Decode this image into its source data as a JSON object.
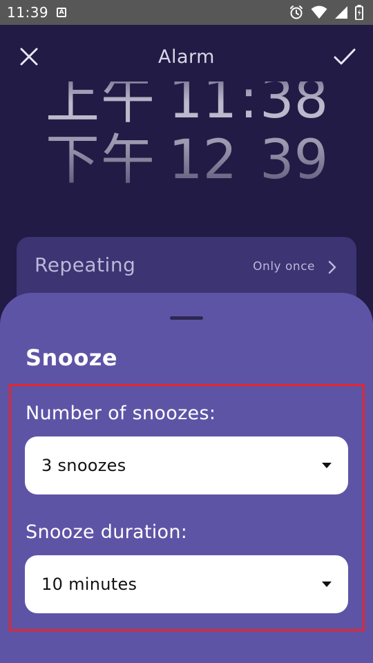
{
  "status_bar": {
    "time": "11:39",
    "notification_icon_letter": "A",
    "icons": [
      "alarm-icon",
      "wifi-icon",
      "signal-icon",
      "battery-icon"
    ]
  },
  "app_bar": {
    "title": "Alarm",
    "close_icon": "close-icon",
    "save_icon": "check-icon"
  },
  "time_picker": {
    "previous": {
      "period": "上午",
      "hour": "11",
      "separator": ":",
      "minute": "38"
    },
    "selected": {
      "period": "下午",
      "hour": "12",
      "separator": "",
      "minute": "39"
    }
  },
  "repeating": {
    "label": "Repeating",
    "value": "Only once",
    "icon": "chevron-right-icon"
  },
  "snooze_sheet": {
    "title": "Snooze",
    "number_of_snoozes": {
      "label": "Number of snoozes:",
      "value": "3 snoozes"
    },
    "snooze_duration": {
      "label": "Snooze duration:",
      "value": "10 minutes"
    }
  },
  "colors": {
    "background": "#211b45",
    "status_bar": "#575757",
    "card": "#3c3473",
    "sheet": "#5e54a6",
    "highlight": "#e6252f",
    "dropdown": "#ffffff"
  }
}
